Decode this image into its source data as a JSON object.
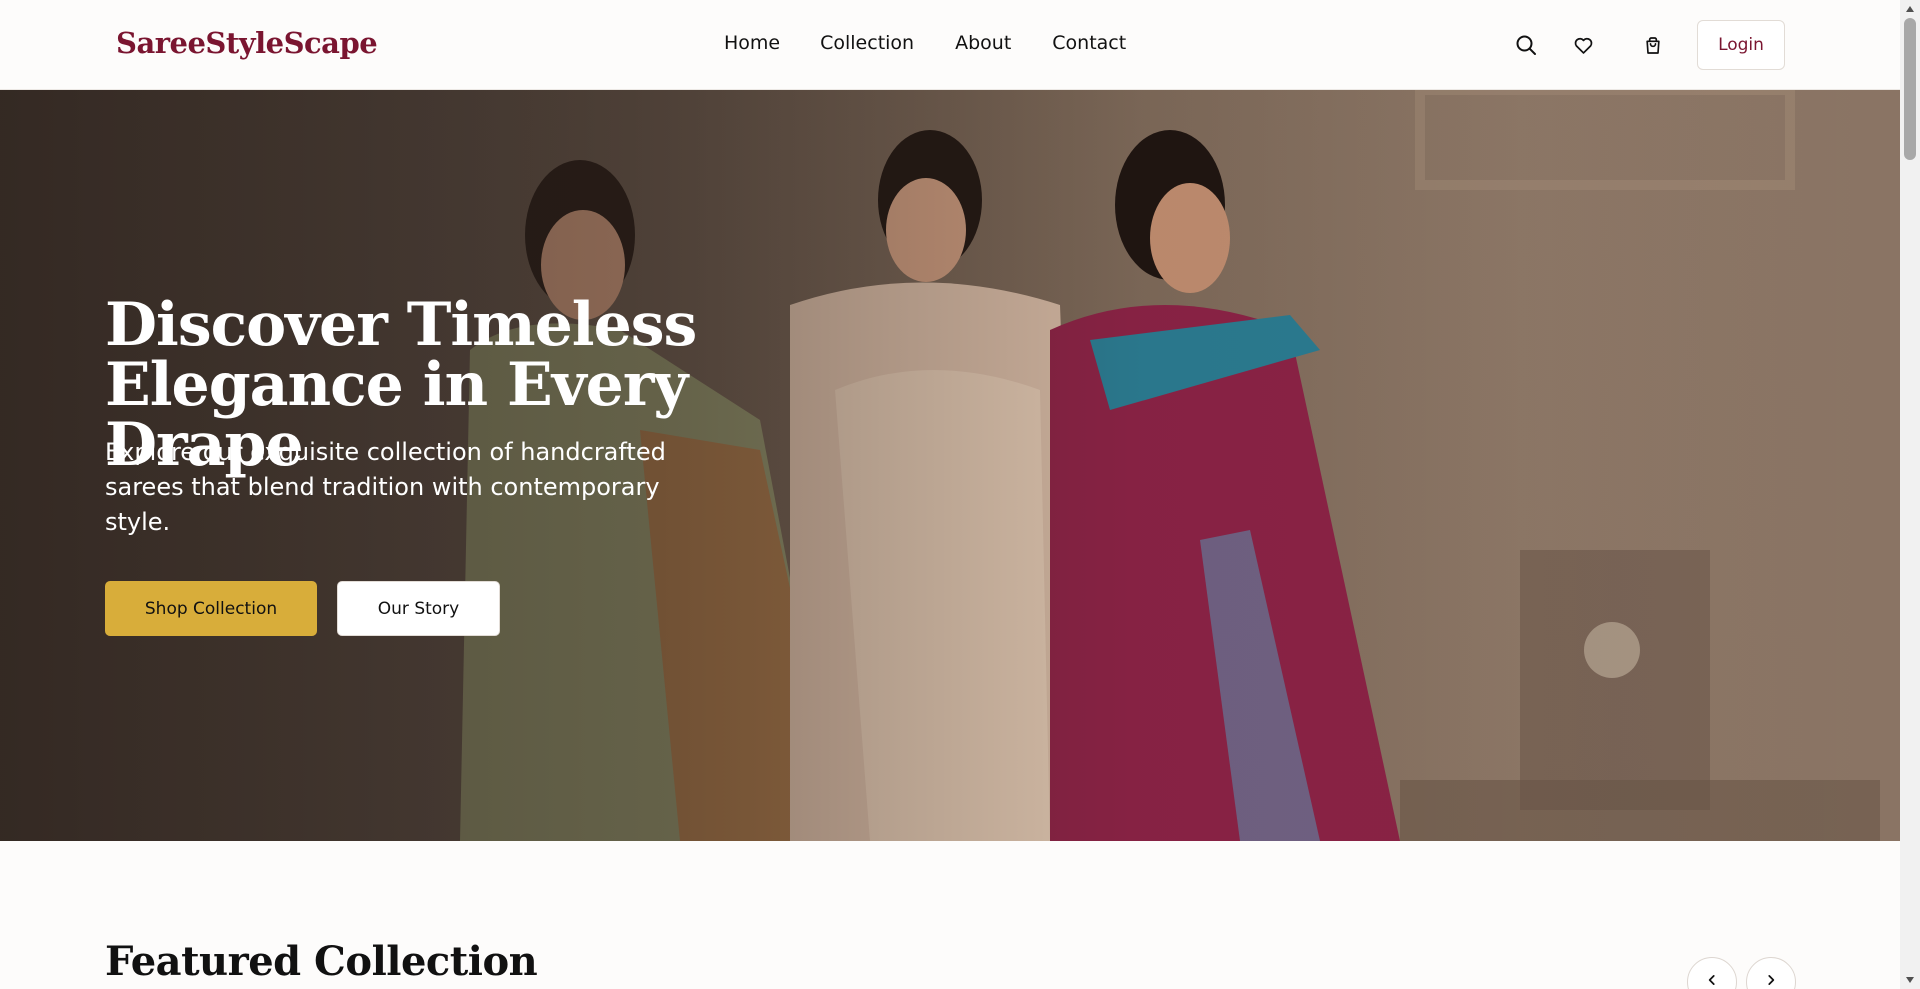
{
  "header": {
    "logo": "SareeStyleScape",
    "nav": [
      "Home",
      "Collection",
      "About",
      "Contact"
    ],
    "icons": [
      "search-icon",
      "heart-icon",
      "shopping-bag-icon"
    ],
    "login_label": "Login"
  },
  "hero": {
    "title_line1": "Discover Timeless",
    "title_line2": "Elegance in Every Drape",
    "subtitle": "Explore our exquisite collection of handcrafted sarees that blend tradition with contemporary style.",
    "primary_button": "Shop Collection",
    "secondary_button": "Our Story"
  },
  "featured": {
    "title": "Featured Collection",
    "prev_icon": "chevron-left-icon",
    "next_icon": "chevron-right-icon"
  },
  "colors": {
    "brand": "#7a1530",
    "accent_gold": "#d8ad3a",
    "background": "#fdfcfb"
  }
}
